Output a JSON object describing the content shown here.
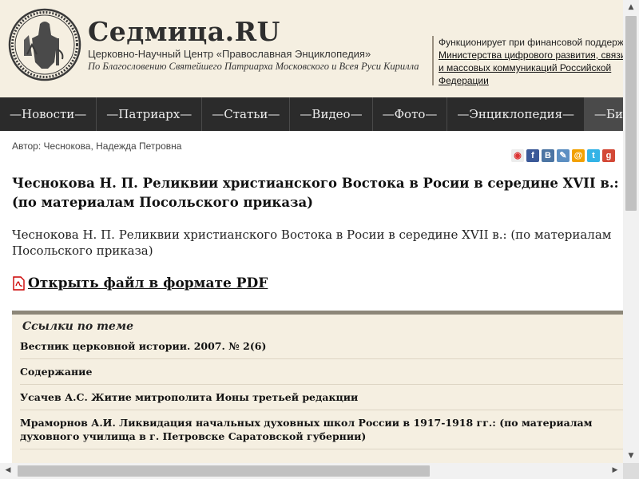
{
  "header": {
    "brand": "Седмица.RU",
    "subtitle": "Церковно-Научный Центр «Православная Энциклопедия»",
    "blessing": "По Благословению Святейшего Патриарха Московского и Всея Руси Кирилла",
    "funding_text": "Функционирует при финансовой поддержке",
    "funding_link": "Министерства цифрового развития, связи и массовых коммуникаций Российской Федерации"
  },
  "nav": [
    {
      "label": "—Новости—"
    },
    {
      "label": "—Патриарх—"
    },
    {
      "label": "—Статьи—"
    },
    {
      "label": "—Видео—"
    },
    {
      "label": "—Фото—"
    },
    {
      "label": "—Энциклопедия—"
    },
    {
      "label": "—Библиотека—"
    }
  ],
  "article": {
    "author": "Автор: Чеснокова, Надежда Петровна",
    "title": "Чеснокова Н. П. Реликвии христианского Востока в Росии в середине XVII в.: (по материалам Посольского приказа)",
    "lead": "Чеснокова Н. П. Реликвии христианского Востока в Росии в середине XVII в.: (по материалам Посольского приказа)",
    "pdf_label": "Открыть файл в формате PDF"
  },
  "share": [
    {
      "icon": "share-feed-icon",
      "glyph": "◉",
      "color": "#e0e0e0"
    },
    {
      "icon": "facebook-icon",
      "glyph": "f",
      "color": "#3b5998"
    },
    {
      "icon": "vk-icon",
      "glyph": "B",
      "color": "#4c75a3"
    },
    {
      "icon": "livejournal-icon",
      "glyph": "✎",
      "color": "#5c8fc2"
    },
    {
      "icon": "mailru-icon",
      "glyph": "@",
      "color": "#f2a100"
    },
    {
      "icon": "twitter-icon",
      "glyph": "t",
      "color": "#33b3e6"
    },
    {
      "icon": "google-icon",
      "glyph": "g",
      "color": "#d34836"
    }
  ],
  "related": {
    "heading": "Ссылки по теме",
    "items": [
      {
        "text": "Вестник церковной истории. 2007. № 2(6)"
      },
      {
        "text": "Содержание"
      },
      {
        "text": "Усачев А.С. Житие митрополита Ионы третьей редакции"
      },
      {
        "text": "Мраморнов А.И. Ликвидация начальных духовных школ России в 1917-1918 гг.: (по материалам духовного училища в г. Петровске Саратовской губернии)"
      }
    ]
  },
  "colors": {
    "header_bg": "#f5efe1",
    "nav_bg": "#2b2b2b",
    "nav_active": "#4a4a4a",
    "related_border": "#8d8779"
  }
}
